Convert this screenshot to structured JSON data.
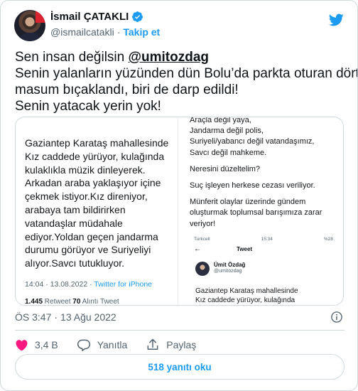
{
  "author": {
    "display_name": "İsmail ÇATAKLI",
    "handle": "@ismailcatakli",
    "separator": "·",
    "follow_label": "Takip et"
  },
  "tweet": {
    "line1_prefix": "Sen insan değilsin ",
    "mention": "@umitozdag",
    "line2": "Senin yalanların yüzünden dün Bolu’da parkta oturan dört",
    "line3": "masum bıçaklandı, biri de darp edildi!",
    "line4": "Senin yatacak yerin yok!"
  },
  "media_left": {
    "lines": [
      "Gaziantep Karataş mahallesinde",
      "Kız caddede yürüyor, kulağında",
      "kulaklıkla müzik dinleyerek.",
      "Arkadan araba yaklaşıyor içine",
      "çekmek istiyor.Kız direniyor,",
      "arabaya tam bildirirken",
      "vatandaşlar müdahale",
      "ediyor.Yoldan geçen jandarma",
      "durumu görüyor ve Suriyeliyi",
      "alıyor.Savcı tutukluyor."
    ],
    "time": "14:04 · 13.08.2022 · ",
    "source": "Twitter for iPhone",
    "retweets": "1.445",
    "retweets_label": " Retweet  ",
    "quotes": "70",
    "quotes_label": " Alıntı Tweet"
  },
  "media_right": {
    "lines": [
      "Araçla değil yaya,",
      "Jandarma değil polis,",
      "Suriyeli/yabancı değil vatandaşımız,",
      "Savcı değil mahkeme.",
      "Neresini düzeltelim?",
      "Suç işleyen herkese cezası veriliyor.",
      "Münferit olaylar üzerinde gündem",
      "oluşturmak toplumsal barışımıza zarar",
      "veriyor!"
    ],
    "phone": {
      "carrier": "Turkcell",
      "clock": "15:34",
      "battery": "%28",
      "nav_title": "Tweet",
      "name": "Ümit Özdağ",
      "handle": "@umitozdag",
      "text_line1": "Gaziantep Karataş mahallesinde",
      "text_line2": "Kız caddede yürüyor, kulağında"
    }
  },
  "meta": {
    "time": "ÖS 3:47",
    "separator": "·",
    "date": "13 Ağu 2022"
  },
  "actions": {
    "like_count": "3,4 B",
    "reply_label": "Yanıtla",
    "share_label": "Paylaş"
  },
  "replies_button": "518 yanıtı oku",
  "colors": {
    "accent": "#1d9bf0",
    "like": "#f91880",
    "text": "#0f1419",
    "muted": "#536471",
    "border": "#cfd9de"
  },
  "icons": [
    "verified-badge-icon",
    "twitter-bird-icon",
    "info-icon",
    "heart-icon",
    "reply-bubble-icon",
    "share-icon",
    "back-arrow-icon"
  ]
}
